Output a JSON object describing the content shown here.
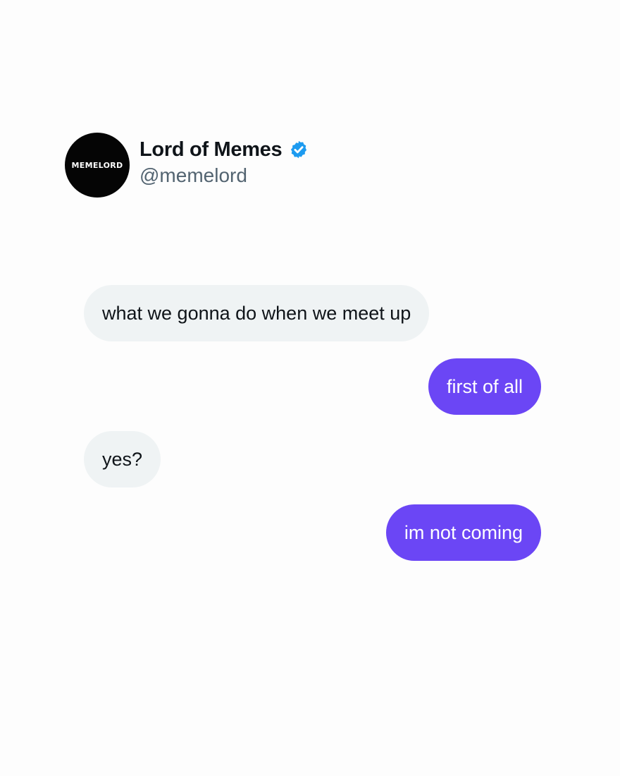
{
  "profile": {
    "avatar_text": "MEMELORD",
    "display_name": "Lord of Memes",
    "handle": "@memelord",
    "verified_icon": "verified-badge-icon",
    "verified_color": "#1d9bf0"
  },
  "messages": [
    {
      "side": "incoming",
      "text": "what we gonna do when we meet up"
    },
    {
      "side": "outgoing",
      "text": "first of all"
    },
    {
      "side": "incoming",
      "text": "yes?"
    },
    {
      "side": "outgoing",
      "text": "im not coming"
    }
  ],
  "colors": {
    "incoming_bubble": "#eff3f4",
    "outgoing_bubble": "#6b46f5",
    "avatar_bg": "#050505"
  }
}
